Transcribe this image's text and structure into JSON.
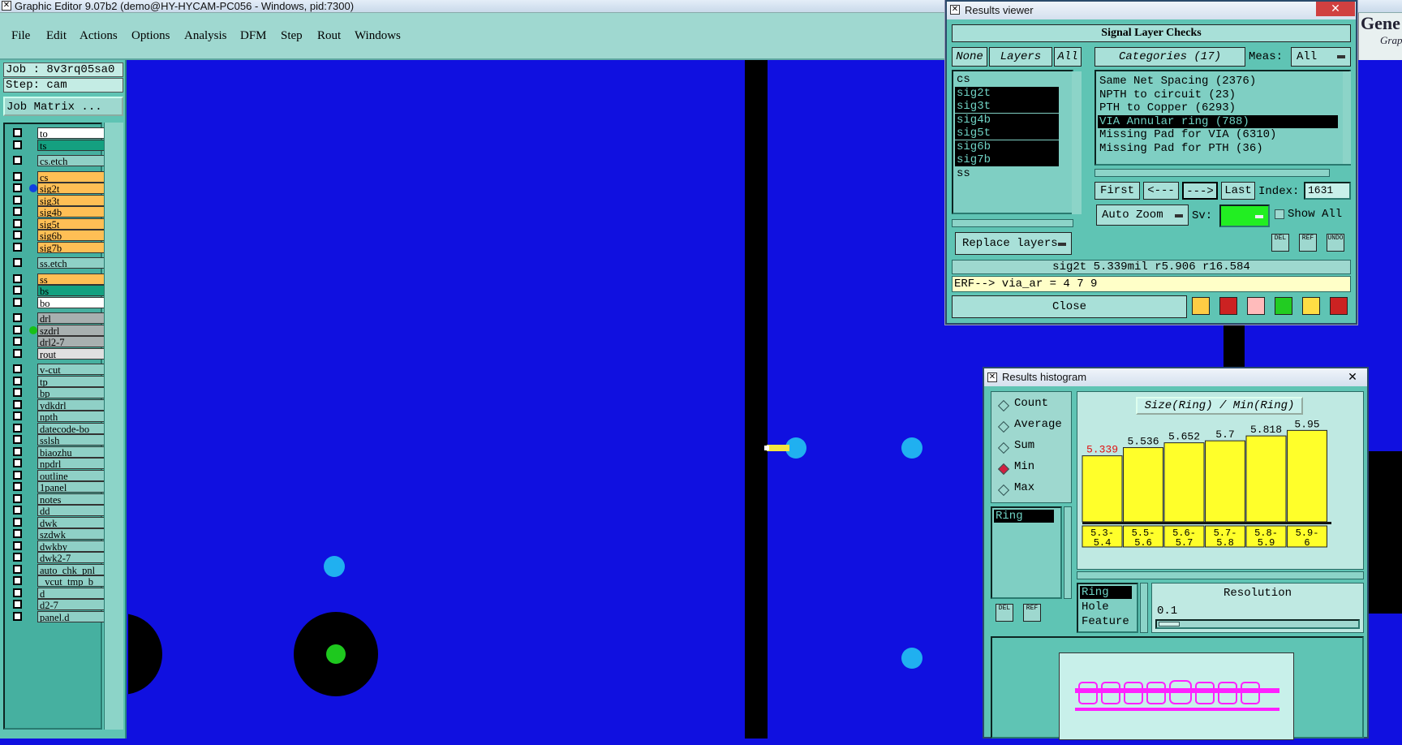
{
  "window": {
    "title": "Graphic Editor 9.07b2 (demo@HY-HYCAM-PC056 - Windows, pid:7300)"
  },
  "menu": {
    "items": [
      "File",
      "Edit",
      "Actions",
      "Options",
      "Analysis",
      "DFM",
      "Step",
      "Rout",
      "Windows"
    ]
  },
  "left": {
    "job": "Job : 8v3rq05sa0",
    "step": "Step: cam",
    "matrix_button": "Job Matrix ..."
  },
  "layers": [
    {
      "name": "to",
      "color": "#ffffff"
    },
    {
      "name": "ts",
      "color": "#14a080"
    },
    {
      "name": "cs.etch",
      "color": "#8fd0c6",
      "gap": true
    },
    {
      "name": "cs",
      "color": "#ffbf55",
      "gap": true
    },
    {
      "name": "sig2t",
      "color": "#ffbf55",
      "dot": "#1040e0"
    },
    {
      "name": "sig3t",
      "color": "#ffbf55"
    },
    {
      "name": "sig4b",
      "color": "#ffbf55"
    },
    {
      "name": "sig5t",
      "color": "#ffbf55"
    },
    {
      "name": "sig6b",
      "color": "#ffbf55"
    },
    {
      "name": "sig7b",
      "color": "#ffbf55"
    },
    {
      "name": "ss.etch",
      "color": "#8fd0c6",
      "gap": true
    },
    {
      "name": "ss",
      "color": "#ffbf55",
      "gap": true
    },
    {
      "name": "bs",
      "color": "#14a080"
    },
    {
      "name": "bo",
      "color": "#ffffff"
    },
    {
      "name": "drl",
      "color": "#a8b0b0",
      "gap": true
    },
    {
      "name": "szdrl",
      "color": "#a8b0b0",
      "dot": "#18c018",
      "active": true
    },
    {
      "name": "drl2-7",
      "color": "#a8b0b0"
    },
    {
      "name": "rout",
      "color": "#e0e0e0"
    },
    {
      "name": "v-cut",
      "color": "#8fd0c6",
      "gap": true
    },
    {
      "name": "tp",
      "color": "#8fd0c6"
    },
    {
      "name": "bp",
      "color": "#8fd0c6"
    },
    {
      "name": "ydkdrl",
      "color": "#8fd0c6"
    },
    {
      "name": "npth",
      "color": "#8fd0c6"
    },
    {
      "name": "datecode-bo",
      "color": "#8fd0c6"
    },
    {
      "name": "sslsh",
      "color": "#8fd0c6"
    },
    {
      "name": "biaozhu",
      "color": "#8fd0c6"
    },
    {
      "name": "npdrl",
      "color": "#8fd0c6"
    },
    {
      "name": "outline",
      "color": "#8fd0c6"
    },
    {
      "name": "1panel",
      "color": "#8fd0c6"
    },
    {
      "name": "notes",
      "color": "#8fd0c6"
    },
    {
      "name": "dd",
      "color": "#8fd0c6"
    },
    {
      "name": "dwk",
      "color": "#8fd0c6"
    },
    {
      "name": "szdwk",
      "color": "#8fd0c6"
    },
    {
      "name": "dwkby",
      "color": "#8fd0c6"
    },
    {
      "name": "dwk2-7",
      "color": "#8fd0c6"
    },
    {
      "name": "auto_chk_pnl",
      "color": "#8fd0c6"
    },
    {
      "name": "_vcut_tmp_b",
      "color": "#8fd0c6"
    },
    {
      "name": "d",
      "color": "#8fd0c6"
    },
    {
      "name": "d2-7",
      "color": "#8fd0c6"
    },
    {
      "name": "panel.d",
      "color": "#8fd0c6"
    }
  ],
  "right_edge": {
    "line1": "Gene",
    "line2": "Grap"
  },
  "results_viewer": {
    "title": "Results viewer",
    "header": "Signal Layer Checks",
    "none_btn": "None",
    "layers_btn": "Layers",
    "all_btn": "All",
    "categories_btn": "Categories (17)",
    "meas_label": "Meas:",
    "meas_value": "All",
    "layer_items": [
      "cs",
      "sig2t",
      "sig3t",
      "sig4b",
      "sig5t",
      "sig6b",
      "sig7b",
      "ss"
    ],
    "selected_layers": [
      "sig2t",
      "sig3t",
      "sig4b",
      "sig5t",
      "sig6b",
      "sig7b"
    ],
    "categories": [
      "Same Net Spacing (2376)",
      "NPTH to circuit (23)",
      "PTH to Copper (6293)",
      "VIA Annular ring (788)",
      "Missing Pad for VIA (6310)",
      "Missing Pad for PTH (36)"
    ],
    "selected_category": "VIA Annular ring (788)",
    "first": "First",
    "prev": "<---",
    "next": "--->",
    "last": "Last",
    "index_label": "Index:",
    "index_value": "1631",
    "auto_zoom": "Auto Zoom",
    "sv_label": "Sv:",
    "show_all": "Show All",
    "replace_layers": "Replace layers",
    "status": "sig2t 5.339mil   r5.906  r16.584",
    "erf": "ERF--> via_ar = 4 7 9",
    "close": "Close",
    "icon_del": "DEL",
    "icon_ref": "REF",
    "icon_undo": "UNDO"
  },
  "histogram": {
    "title": "Results histogram",
    "modes": [
      "Count",
      "Average",
      "Sum",
      "Min",
      "Max"
    ],
    "selected_mode": "Min",
    "graph_title": "Size(Ring) / Min(Ring)",
    "list_items": [
      "Ring"
    ],
    "fields": [
      "Ring",
      "Hole",
      "Feature"
    ],
    "resolution_label": "Resolution",
    "resolution_value": "0.1",
    "icon_del": "DEL",
    "icon_ref": "REF"
  },
  "chart_data": {
    "type": "bar",
    "title": "Size(Ring) / Min(Ring)",
    "categories": [
      "5.3-5.4",
      "5.5-5.6",
      "5.6-5.7",
      "5.7-5.8",
      "5.8-5.9",
      "5.9-6"
    ],
    "values": [
      5.339,
      5.536,
      5.652,
      5.7,
      5.818,
      5.95
    ],
    "labels": [
      "5.339",
      "5.536",
      "5.652",
      "5.7",
      "5.818",
      "5.95"
    ],
    "bin_top": [
      "5.3-",
      "5.5-",
      "5.6-",
      "5.7-",
      "5.8-",
      "5.9-"
    ],
    "bin_bottom": [
      "5.4",
      "5.6",
      "5.7",
      "5.8",
      "5.9",
      "6"
    ],
    "highlight_color": "#e01010",
    "bar_color": "#ffff2a",
    "ylim": [
      5.0,
      6.0
    ]
  }
}
